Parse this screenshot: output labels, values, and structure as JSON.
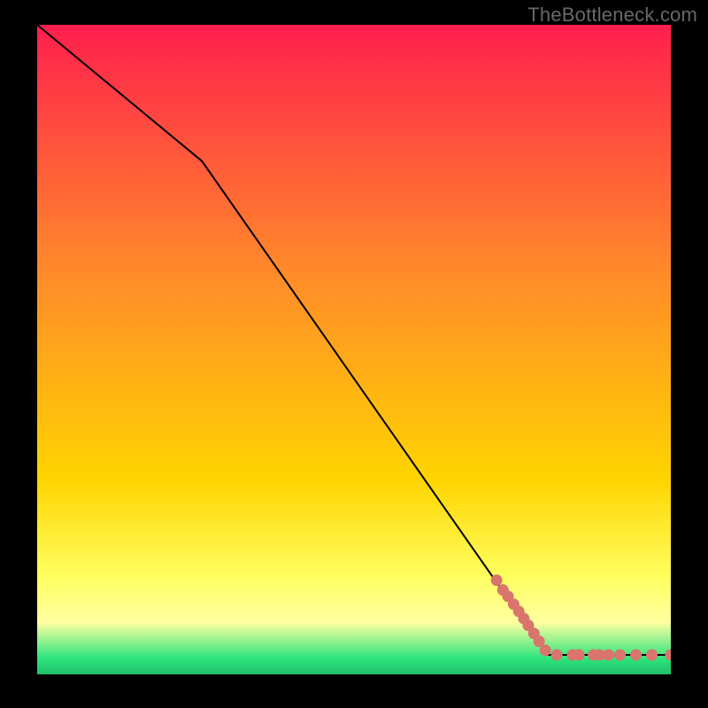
{
  "watermark": "TheBottleneck.com",
  "colors": {
    "gradient_top": "#ff1f4d",
    "gradient_mid": "#ffd400",
    "gradient_yellow_pale": "#ffffa0",
    "gradient_green": "#2de57e",
    "line": "#000000",
    "marker": "#d9756d",
    "frame_bg": "#000000"
  },
  "chart_data": {
    "type": "line",
    "title": "",
    "xlabel": "",
    "ylabel": "",
    "xlim": [
      0,
      100
    ],
    "ylim": [
      0,
      100
    ],
    "grid": false,
    "legend": false,
    "line_points": [
      {
        "x": 0,
        "y": 100
      },
      {
        "x": 26,
        "y": 79
      },
      {
        "x": 80.5,
        "y": 3
      },
      {
        "x": 100,
        "y": 3
      }
    ],
    "markers": [
      {
        "x": 72.5,
        "y": 14.5
      },
      {
        "x": 73.5,
        "y": 13
      },
      {
        "x": 74.3,
        "y": 12
      },
      {
        "x": 75.2,
        "y": 10.8
      },
      {
        "x": 76.0,
        "y": 9.7
      },
      {
        "x": 76.8,
        "y": 8.6
      },
      {
        "x": 77.5,
        "y": 7.55
      },
      {
        "x": 78.4,
        "y": 6.3
      },
      {
        "x": 79.2,
        "y": 5.1
      },
      {
        "x": 80.2,
        "y": 3.7
      },
      {
        "x": 82.0,
        "y": 3.0
      },
      {
        "x": 84.5,
        "y": 3.0
      },
      {
        "x": 85.5,
        "y": 3.0
      },
      {
        "x": 87.8,
        "y": 3.0
      },
      {
        "x": 88.8,
        "y": 3.0
      },
      {
        "x": 90.2,
        "y": 3.0
      },
      {
        "x": 92.0,
        "y": 3.0
      },
      {
        "x": 94.5,
        "y": 3.0
      },
      {
        "x": 97.0,
        "y": 3.0
      },
      {
        "x": 100.0,
        "y": 3.0
      }
    ]
  }
}
